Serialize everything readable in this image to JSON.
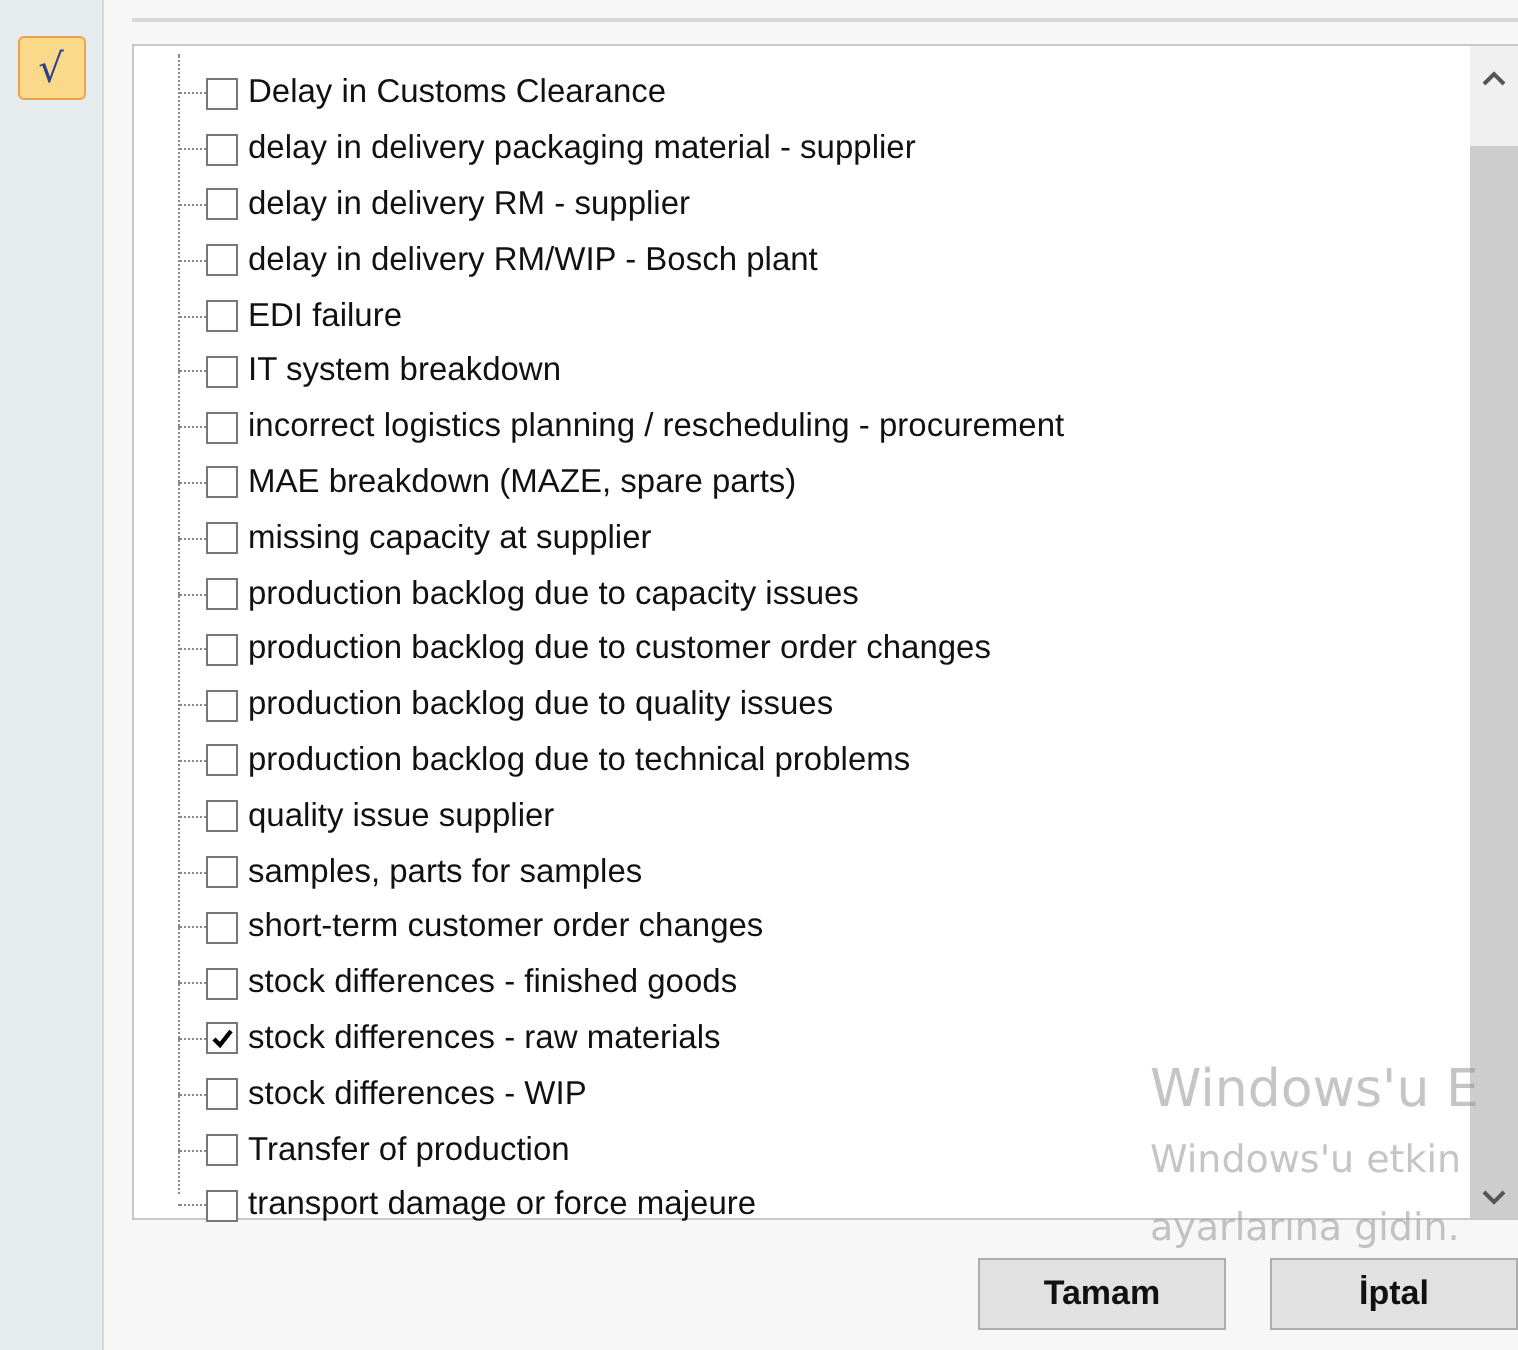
{
  "side_button": {
    "label": "√",
    "selected": true
  },
  "items": [
    {
      "label": "Delay in Customs Clearance",
      "checked": false
    },
    {
      "label": "delay in delivery packaging material - supplier",
      "checked": false
    },
    {
      "label": "delay in delivery RM - supplier",
      "checked": false
    },
    {
      "label": "delay in delivery RM/WIP - Bosch plant",
      "checked": false
    },
    {
      "label": "EDI failure",
      "checked": false
    },
    {
      "label": "IT system breakdown",
      "checked": false
    },
    {
      "label": "incorrect logistics planning / rescheduling - procurement",
      "checked": false
    },
    {
      "label": "MAE breakdown (MAZE, spare parts)",
      "checked": false
    },
    {
      "label": "missing capacity at supplier",
      "checked": false
    },
    {
      "label": "production backlog due to capacity issues",
      "checked": false
    },
    {
      "label": "production backlog due to customer order changes",
      "checked": false
    },
    {
      "label": "production backlog due to quality issues",
      "checked": false
    },
    {
      "label": "production backlog due to technical problems",
      "checked": false
    },
    {
      "label": "quality issue supplier",
      "checked": false
    },
    {
      "label": "samples, parts for samples",
      "checked": false
    },
    {
      "label": "short-term customer order changes",
      "checked": false
    },
    {
      "label": "stock differences - finished goods",
      "checked": false
    },
    {
      "label": "stock differences - raw materials",
      "checked": true
    },
    {
      "label": "stock differences - WIP",
      "checked": false
    },
    {
      "label": "Transfer of production",
      "checked": false
    },
    {
      "label": "transport damage or force majeure",
      "checked": false
    }
  ],
  "buttons": [
    "Tamam",
    "İptal"
  ],
  "activation_notice": {
    "title": "Windows'u E",
    "lines": [
      "Windows'u etkin",
      "ayarlarına gidin."
    ]
  }
}
